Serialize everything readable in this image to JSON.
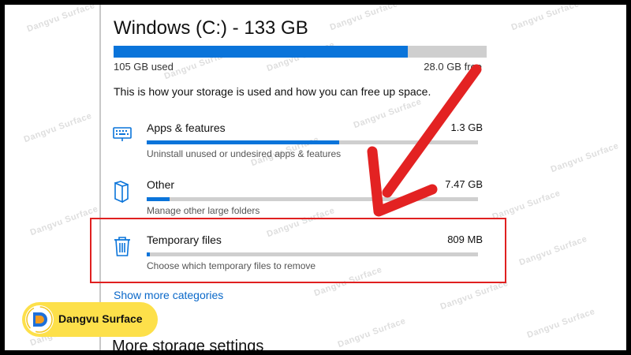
{
  "drive": {
    "title": "Windows (C:) - 133 GB",
    "used_label": "105 GB used",
    "free_label": "28.0 GB free",
    "used_fraction": 0.789,
    "description": "This is how your storage is used and how you can free up space."
  },
  "categories": [
    {
      "name": "Apps & features",
      "size": "1.3 GB",
      "subtitle": "Uninstall unused or undesired apps & features",
      "fill_fraction": 0.58,
      "icon": "keyboard-icon"
    },
    {
      "name": "Other",
      "size": "7.47 GB",
      "subtitle": "Manage other large folders",
      "fill_fraction": 0.07,
      "icon": "folder-icon"
    },
    {
      "name": "Temporary files",
      "size": "809 MB",
      "subtitle": "Choose which temporary files to remove",
      "fill_fraction": 0.01,
      "icon": "trash-icon"
    }
  ],
  "links": {
    "show_more": "Show more categories"
  },
  "sections": {
    "more_storage": "More storage settings"
  },
  "branding": {
    "logo_text": "Dangvu Surface",
    "watermark_text": "Dangvu Surface"
  },
  "colors": {
    "accent": "#0a74da",
    "bar_track": "#cfcfcf",
    "highlight": "#e02020",
    "badge": "#fde04a"
  }
}
